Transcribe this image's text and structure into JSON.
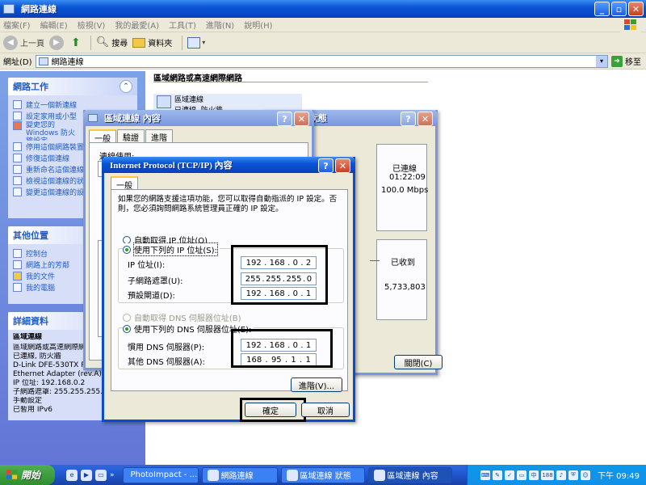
{
  "explorer": {
    "title": "網路連線",
    "caption_buttons": {
      "min": "_",
      "max": "▫",
      "close": "✕"
    },
    "menu": [
      "檔案(F)",
      "編輯(E)",
      "檢視(V)",
      "我的最愛(A)",
      "工具(T)",
      "進階(N)",
      "說明(H)"
    ],
    "toolbar": {
      "back": "上一頁",
      "search": "搜尋",
      "folders": "資料夾"
    },
    "address_label": "網址(D)",
    "address_value": "網路連線",
    "go_label": "移至",
    "content_header": "區域網路或高速網際網路",
    "connection": {
      "name": "區域連線",
      "status": "已連線, 防火牆"
    }
  },
  "taskpane": {
    "network_tasks": {
      "title": "網路工作",
      "items": [
        "建立一個新連線",
        "設定家用或小型",
        "變更您的 Windows 防火牆設定",
        "停用這個網路裝置",
        "修復這個連線",
        "重新命名這個連線",
        "檢視這個連線的狀態",
        "變更這個連線的設定"
      ]
    },
    "other_places": {
      "title": "其他位置",
      "items": [
        "控制台",
        "網路上的芳鄰",
        "我的文件",
        "我的電腦"
      ]
    },
    "details": {
      "title": "詳細資料",
      "name": "區域連線",
      "lines": [
        "區域網路或高速網際網路",
        "已連線, 防火牆",
        "D-Link DFE-530TX P",
        "Ethernet Adapter (rev.A)",
        "IP 位址: 192.168.0.2",
        "子網路遮罩: 255.255.255.0",
        "手動設定",
        "已暫用 IPv6"
      ]
    }
  },
  "status_dialog": {
    "title": "區域連線 狀態",
    "lines": [
      "已連線",
      "01:22:09",
      "100.0 Mbps"
    ],
    "received_label": "已收到",
    "received_bytes": "5,733,803",
    "close_button": "關閉(C)"
  },
  "props_dialog": {
    "title": "區域連線 內容",
    "tabs": [
      "一般",
      "驗證",
      "進階"
    ],
    "connect_using": "連線使用:"
  },
  "tcpip_dialog": {
    "title": "Internet Protocol (TCP/IP) 內容",
    "tab": "一般",
    "intro": "如果您的網路支援這項功能，您可以取得自動指派的 IP 設定。否則，您必須詢問網路系統管理員正確的 IP 設定。",
    "auto_ip": "自動取得 IP 位址(O)",
    "manual_ip": "使用下列的 IP 位址(S):",
    "ip_label": "IP 位址(I):",
    "ip": [
      "192",
      "168",
      "0",
      "2"
    ],
    "mask_label": "子網路遮罩(U):",
    "mask": [
      "255",
      "255",
      "255",
      "0"
    ],
    "gateway_label": "預設閘道(D):",
    "gateway": [
      "192",
      "168",
      "0",
      "1"
    ],
    "auto_dns": "自動取得 DNS 伺服器位址(B)",
    "manual_dns": "使用下列的 DNS 伺服器位址(E):",
    "dns1_label": "慣用 DNS 伺服器(P):",
    "dns1": [
      "192",
      "168",
      "0",
      "1"
    ],
    "dns2_label": "其他 DNS 伺服器(A):",
    "dns2": [
      "168",
      "95",
      "1",
      "1"
    ],
    "advanced_button": "進階(V)...",
    "ok_button": "確定",
    "cancel_button": "取消"
  },
  "taskbar": {
    "start": "開始",
    "tasks": [
      "PhotoImpact - ...",
      "網路連線",
      "區域連線 狀態",
      "區域連線 內容"
    ],
    "clock": "下午 09:49",
    "tray_badge": "188"
  }
}
